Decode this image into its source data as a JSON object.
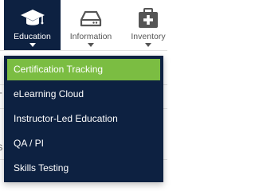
{
  "nav": {
    "items": [
      {
        "label": "Education",
        "icon": "graduation-cap-icon"
      },
      {
        "label": "Information",
        "icon": "hard-drive-icon"
      },
      {
        "label": "Inventory",
        "icon": "medical-kit-icon"
      }
    ]
  },
  "dropdown": {
    "items": [
      {
        "label": "Certification Tracking",
        "active": true
      },
      {
        "label": "eLearning Cloud"
      },
      {
        "label": "Instructor-Led Education"
      },
      {
        "label": "QA / PI"
      },
      {
        "label": "Skills Testing"
      }
    ]
  },
  "background": {
    "row_a": "T",
    "row_b": "S"
  },
  "colors": {
    "nav_active_bg": "#0d2141",
    "dropdown_bg": "#0d2141",
    "item_highlight": "#7bbd42",
    "nav_inactive_text": "#555555"
  }
}
